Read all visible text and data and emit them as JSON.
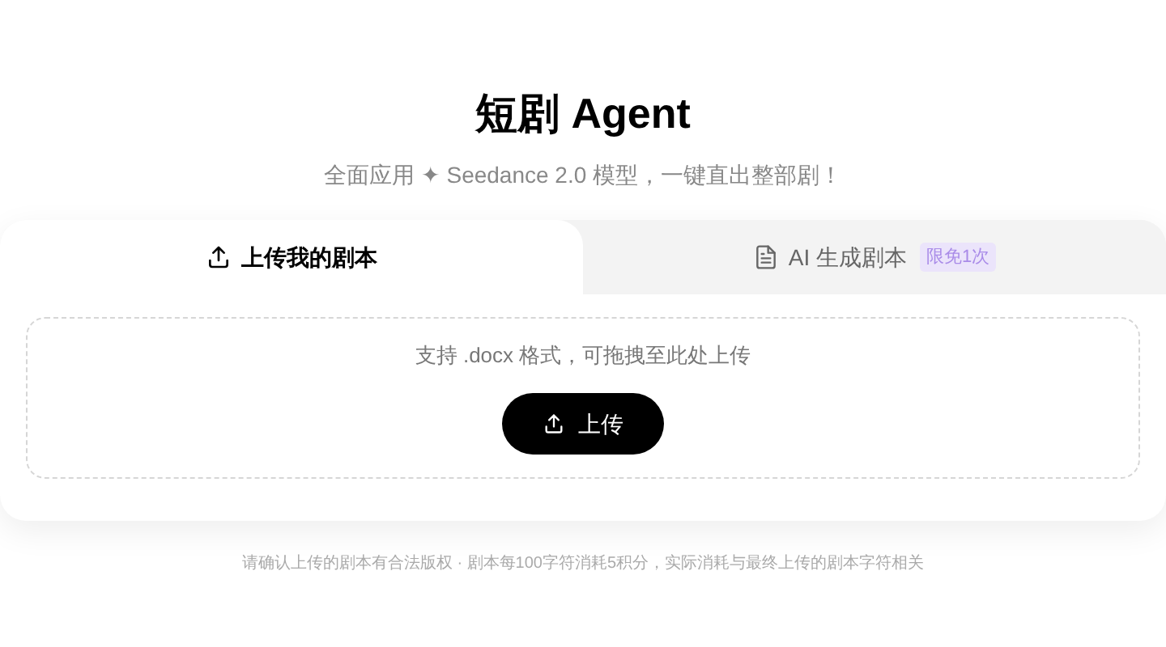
{
  "title": "短剧 Agent",
  "subtitle": "全面应用 ✦ Seedance 2.0 模型，一键直出整部剧！",
  "tabs": [
    {
      "label": "上传我的剧本",
      "selected": true,
      "kind": "upload"
    },
    {
      "label": "AI 生成剧本",
      "selected": false,
      "kind": "document",
      "badge": "限免1次"
    }
  ],
  "dropzone": {
    "hint": "支持 .docx 格式，可拖拽至此处上传",
    "button": "上传"
  },
  "footnote": "请确认上传的剧本有合法版权 · 剧本每100字符消耗5积分，实际消耗与最终上传的剧本字符相关"
}
